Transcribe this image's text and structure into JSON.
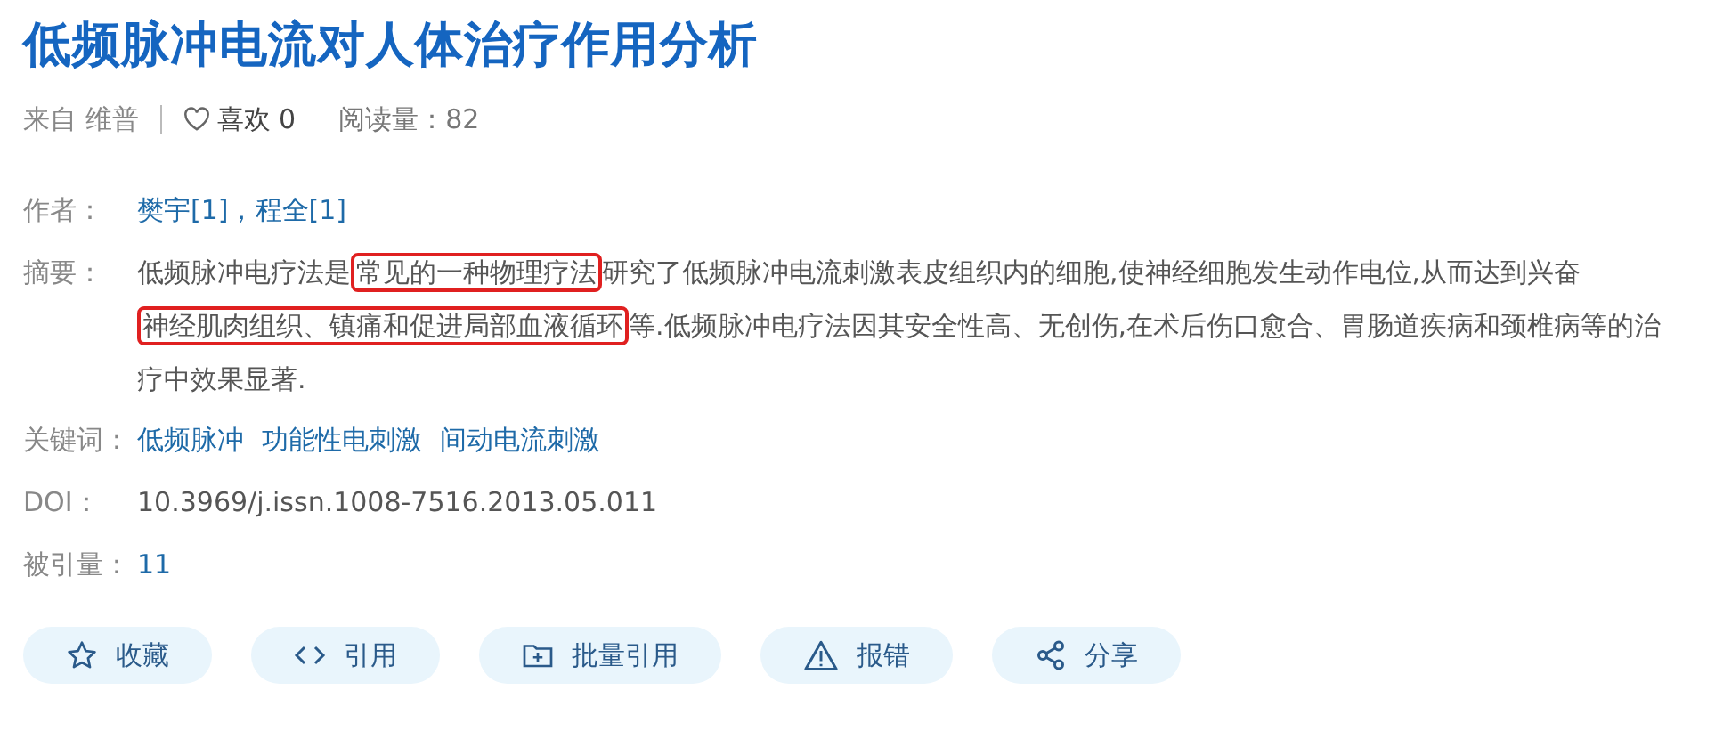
{
  "title": "低频脉冲电流对人体治疗作用分析",
  "meta": {
    "source": "来自 维普",
    "likes": "喜欢 0",
    "reads": "阅读量：82"
  },
  "fields": [
    {
      "kind": "links",
      "label": "作者：",
      "items": [
        "樊宇[1]",
        "程全[1]"
      ],
      "separator": "，"
    },
    {
      "kind": "abstract",
      "label": "摘要：",
      "segments": [
        {
          "text": "低频脉冲电疗法是",
          "highlighted": false
        },
        {
          "text": "常见的一种物理疗法",
          "highlighted": true
        },
        {
          "text": "研究了低频脉冲电流刺激表皮组织内的细胞,使神经细胞发生动作电位,从而达到兴奋",
          "highlighted": false
        },
        {
          "text": "神经肌肉组织、镇痛和促进局部血液循环",
          "highlighted": true
        },
        {
          "text": "等.低频脉冲电疗法因其安全性高、无创伤,在术后伤口愈合、胃肠道疾病和颈椎病等的治疗中效果显著.",
          "highlighted": false
        }
      ]
    },
    {
      "kind": "links",
      "label": "关键词：",
      "items": [
        "低频脉冲",
        "功能性电刺激",
        "间动电流刺激"
      ]
    },
    {
      "kind": "text",
      "label": "DOI：",
      "value": "10.3969/j.issn.1008-7516.2013.05.011"
    },
    {
      "kind": "links",
      "label": "被引量：",
      "items": [
        "11"
      ]
    }
  ],
  "buttons": [
    "收藏",
    "引用",
    "批量引用",
    "报错",
    "分享"
  ]
}
